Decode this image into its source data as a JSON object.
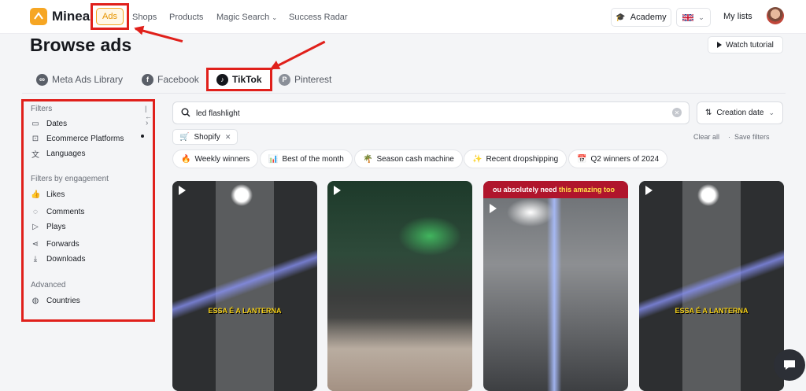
{
  "nav": {
    "brand": "Minea",
    "links": [
      {
        "label": "Ads"
      },
      {
        "label": "Shops"
      },
      {
        "label": "Products"
      },
      {
        "label": "Magic Search"
      },
      {
        "label": "Success Radar"
      }
    ],
    "academy": "Academy",
    "my_lists": "My lists"
  },
  "header": {
    "title": "Browse ads",
    "watch_tutorial": "Watch tutorial"
  },
  "tabs": [
    {
      "label": "Meta Ads Library",
      "icon": "meta-icon"
    },
    {
      "label": "Facebook",
      "icon": "facebook-icon"
    },
    {
      "label": "TikTok",
      "icon": "tiktok-icon",
      "active": true
    },
    {
      "label": "Pinterest",
      "icon": "pinterest-icon"
    }
  ],
  "sidebar": {
    "filters_title": "Filters",
    "items": [
      {
        "label": "Dates",
        "icon": "calendar-icon"
      },
      {
        "label": "Ecommerce Platforms",
        "icon": "cart-icon"
      },
      {
        "label": "Languages",
        "icon": "translate-icon"
      }
    ],
    "engagement_title": "Filters by engagement",
    "engagement": [
      {
        "label": "Likes",
        "icon": "thumbs-up-icon"
      },
      {
        "label": "Comments",
        "icon": "comment-icon"
      },
      {
        "label": "Plays",
        "icon": "play-icon"
      },
      {
        "label": "Forwards",
        "icon": "share-icon"
      },
      {
        "label": "Downloads",
        "icon": "download-icon"
      }
    ],
    "advanced_title": "Advanced",
    "advanced": [
      {
        "label": "Countries",
        "icon": "globe-icon"
      }
    ]
  },
  "search": {
    "value": "led flashlight"
  },
  "sort": {
    "label": "Creation date"
  },
  "active_filter": {
    "label": "Shopify"
  },
  "actions": {
    "clear_all": "Clear all",
    "save_filters": "Save filters"
  },
  "presets": [
    {
      "label": "Weekly winners",
      "icon": "fire-icon"
    },
    {
      "label": "Best of the month",
      "icon": "chart-icon"
    },
    {
      "label": "Season cash machine",
      "icon": "palm-icon"
    },
    {
      "label": "Recent dropshipping",
      "icon": "sparkle-icon"
    },
    {
      "label": "Q2 winners of 2024",
      "icon": "calendar-icon"
    }
  ],
  "cards": [
    {
      "caption": "ESSA É A LANTERNA"
    },
    {
      "caption": ""
    },
    {
      "banner_pre": "ou absolutely need ",
      "banner_hl": "this amazing too",
      "caption": ""
    },
    {
      "caption": "ESSA É A LANTERNA"
    }
  ],
  "colors": {
    "accent": "#f6a623",
    "annotation": "#e0201b",
    "banner": "#b0152c"
  }
}
